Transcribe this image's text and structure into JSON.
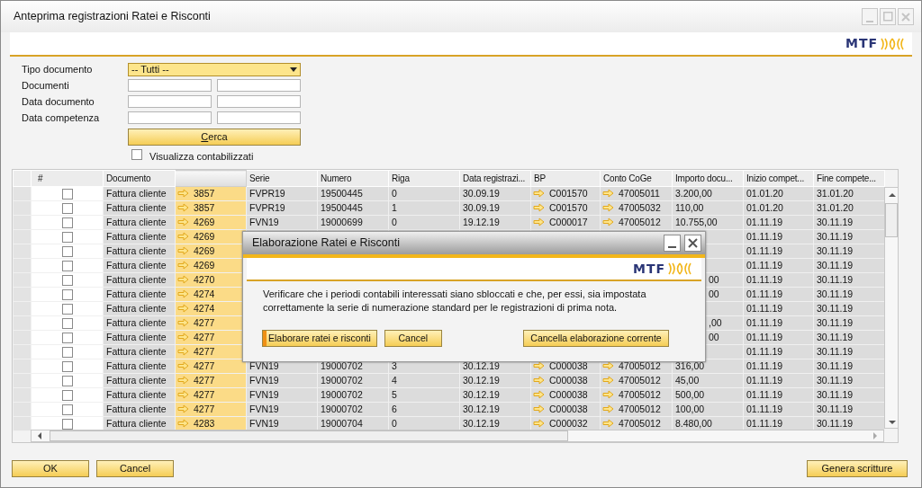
{
  "window": {
    "title": "Anteprima registrazioni Ratei e Risconti",
    "controls": [
      {
        "kind": "minimize",
        "disabled": true
      },
      {
        "kind": "maximize",
        "disabled": true
      },
      {
        "kind": "close",
        "disabled": true
      }
    ]
  },
  "logo": {
    "text": "MTF"
  },
  "filters": {
    "tipo_documento": {
      "label": "Tipo documento",
      "value": "-- Tutti --"
    },
    "ranges": [
      {
        "label": "Documenti"
      },
      {
        "label": "Data documento"
      },
      {
        "label": "Data competenza"
      }
    ],
    "search_button": "Cerca",
    "show_posted": {
      "label": "Visualizza contabilizzati",
      "checked": false
    }
  },
  "table": {
    "columns": [
      {
        "label": "#",
        "selected": false
      },
      {
        "label": "Documento",
        "selected": false
      },
      {
        "selected": true
      },
      {
        "label": "Serie",
        "selected": false
      },
      {
        "label": "Numero",
        "selected": false
      },
      {
        "label": "Riga",
        "selected": false
      },
      {
        "label": "Data registrazi...",
        "selected": false
      },
      {
        "label": "BP",
        "selected": false
      },
      {
        "label": "Conto CoGe",
        "selected": false
      },
      {
        "label": "Importo docu...",
        "selected": false
      },
      {
        "label": "Inizio compet...",
        "selected": false
      },
      {
        "label": "Fine compete...",
        "selected": false
      }
    ],
    "rows": [
      {
        "checked": false,
        "documento": "Fattura cliente",
        "doc": "3857",
        "serie": "FVPR19",
        "numero": "19500445",
        "riga": "0",
        "data": "30.09.19",
        "bp": "C001570",
        "conto": "47005011",
        "importo": "3.200,00",
        "inizio": "01.01.20",
        "fine": "31.01.20"
      },
      {
        "checked": false,
        "documento": "Fattura cliente",
        "doc": "3857",
        "serie": "FVPR19",
        "numero": "19500445",
        "riga": "1",
        "data": "30.09.19",
        "bp": "C001570",
        "conto": "47005032",
        "importo": "110,00",
        "inizio": "01.01.20",
        "fine": "31.01.20"
      },
      {
        "checked": false,
        "documento": "Fattura cliente",
        "doc": "4269",
        "serie": "FVN19",
        "numero": "19000699",
        "riga": "0",
        "data": "19.12.19",
        "bp": "C000017",
        "conto": "47005012",
        "importo": "10.755,00",
        "inizio": "01.11.19",
        "fine": "30.11.19"
      },
      {
        "checked": false,
        "documento": "Fattura cliente",
        "doc": "4269",
        "inizio": "01.11.19",
        "fine": "30.11.19"
      },
      {
        "checked": false,
        "documento": "Fattura cliente",
        "doc": "4269",
        "inizio": "01.11.19",
        "fine": "30.11.19"
      },
      {
        "checked": false,
        "documento": "Fattura cliente",
        "doc": "4269",
        "inizio": "01.11.19",
        "fine": "30.11.19"
      },
      {
        "checked": false,
        "documento": "Fattura cliente",
        "doc": "4270",
        "importo": "00",
        "inizio": "01.11.19",
        "fine": "30.11.19"
      },
      {
        "checked": false,
        "documento": "Fattura cliente",
        "doc": "4274",
        "importo": "00",
        "inizio": "01.11.19",
        "fine": "30.11.19"
      },
      {
        "checked": false,
        "documento": "Fattura cliente",
        "doc": "4274",
        "inizio": "01.11.19",
        "fine": "30.11.19"
      },
      {
        "checked": false,
        "documento": "Fattura cliente",
        "doc": "4277",
        "importo": ",00",
        "inizio": "01.11.19",
        "fine": "30.11.19"
      },
      {
        "checked": false,
        "documento": "Fattura cliente",
        "doc": "4277",
        "importo": "00",
        "inizio": "01.11.19",
        "fine": "30.11.19"
      },
      {
        "checked": false,
        "documento": "Fattura cliente",
        "doc": "4277",
        "inizio": "01.11.19",
        "fine": "30.11.19"
      },
      {
        "checked": false,
        "documento": "Fattura cliente",
        "doc": "4277",
        "serie": "FVN19",
        "numero": "19000702",
        "riga": "3",
        "data": "30.12.19",
        "bp": "C000038",
        "conto": "47005012",
        "importo": "316,00",
        "inizio": "01.11.19",
        "fine": "30.11.19"
      },
      {
        "checked": false,
        "documento": "Fattura cliente",
        "doc": "4277",
        "serie": "FVN19",
        "numero": "19000702",
        "riga": "4",
        "data": "30.12.19",
        "bp": "C000038",
        "conto": "47005012",
        "importo": "45,00",
        "inizio": "01.11.19",
        "fine": "30.11.19"
      },
      {
        "checked": false,
        "documento": "Fattura cliente",
        "doc": "4277",
        "serie": "FVN19",
        "numero": "19000702",
        "riga": "5",
        "data": "30.12.19",
        "bp": "C000038",
        "conto": "47005012",
        "importo": "500,00",
        "inizio": "01.11.19",
        "fine": "30.11.19"
      },
      {
        "checked": false,
        "documento": "Fattura cliente",
        "doc": "4277",
        "serie": "FVN19",
        "numero": "19000702",
        "riga": "6",
        "data": "30.12.19",
        "bp": "C000038",
        "conto": "47005012",
        "importo": "100,00",
        "inizio": "01.11.19",
        "fine": "30.11.19"
      },
      {
        "checked": false,
        "documento": "Fattura cliente",
        "doc": "4283",
        "serie": "FVN19",
        "numero": "19000704",
        "riga": "0",
        "data": "30.12.19",
        "bp": "C000032",
        "conto": "47005012",
        "importo": "8.480,00",
        "inizio": "01.11.19",
        "fine": "30.11.19"
      }
    ]
  },
  "footer_buttons": [
    {
      "label": "OK"
    },
    {
      "label": "Cancel"
    },
    {
      "label": "Genera scritture"
    }
  ],
  "dialog": {
    "title": "Elaborazione Ratei e Risconti",
    "logo_text": "MTF",
    "message": "Verificare che i periodi contabili interessati siano sbloccati e che, per essi, sia impostata correttamente la serie di numerazione standard per le registrazioni di prima nota.",
    "buttons": [
      {
        "label": "Elaborare ratei e risconti",
        "focused": true
      },
      {
        "label": "Cancel",
        "focused": false
      },
      {
        "label": "Cancella elaborazione corrente",
        "focused": false
      }
    ]
  }
}
